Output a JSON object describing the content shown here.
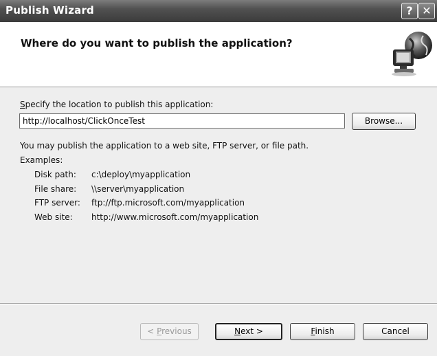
{
  "window": {
    "title": "Publish Wizard",
    "help_glyph": "?",
    "close_glyph": "✕"
  },
  "header": {
    "title": "Where do you want to publish the application?",
    "icon": "globe-computer-icon"
  },
  "location": {
    "label_accel": "S",
    "label_rest": "pecify the location to publish this application:",
    "value": "http://localhost/ClickOnceTest",
    "browse_label": "Browse..."
  },
  "info": {
    "may_publish": "You may publish the application to a web site, FTP server, or file path.",
    "examples_label": "Examples:",
    "examples": [
      {
        "key": "Disk path:",
        "value": "c:\\deploy\\myapplication"
      },
      {
        "key": "File share:",
        "value": "\\\\server\\myapplication"
      },
      {
        "key": "FTP server:",
        "value": "ftp://ftp.microsoft.com/myapplication"
      },
      {
        "key": "Web site:",
        "value": "http://www.microsoft.com/myapplication"
      }
    ]
  },
  "footer": {
    "previous_prefix": "< ",
    "previous_accel": "P",
    "previous_rest": "revious",
    "next_accel": "N",
    "next_rest": "ext >",
    "finish_accel": "F",
    "finish_rest": "inish",
    "cancel_label": "Cancel",
    "previous_enabled": false
  }
}
